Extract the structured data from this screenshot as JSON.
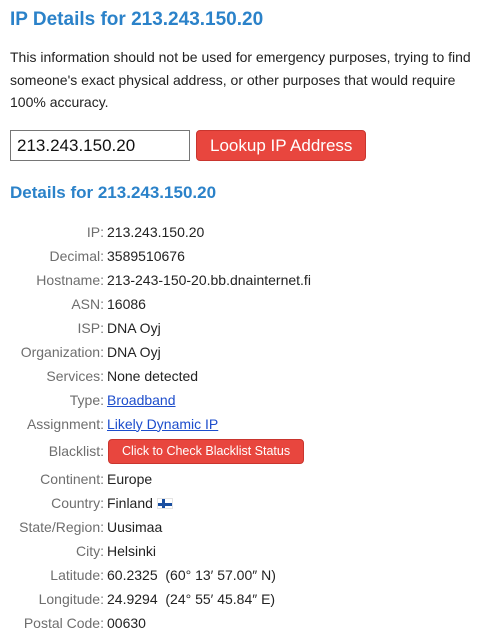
{
  "page": {
    "title": "IP Details for 213.243.150.20",
    "disclaimer": "This information should not be used for emergency purposes, trying to find someone's exact physical address, or other purposes that would require 100% accuracy."
  },
  "lookup": {
    "input_value": "213.243.150.20",
    "button_label": "Lookup IP Address"
  },
  "details": {
    "title": "Details for 213.243.150.20",
    "ip": {
      "label": "IP:",
      "value": "213.243.150.20"
    },
    "decimal": {
      "label": "Decimal:",
      "value": "3589510676"
    },
    "hostname": {
      "label": "Hostname:",
      "value": "213-243-150-20.bb.dnainternet.fi"
    },
    "asn": {
      "label": "ASN:",
      "value": "16086"
    },
    "isp": {
      "label": "ISP:",
      "value": "DNA Oyj"
    },
    "organization": {
      "label": "Organization:",
      "value": "DNA Oyj"
    },
    "services": {
      "label": "Services:",
      "value": "None detected"
    },
    "type": {
      "label": "Type:",
      "value": "Broadband"
    },
    "assignment": {
      "label": "Assignment:",
      "value": "Likely Dynamic IP"
    },
    "blacklist": {
      "label": "Blacklist:",
      "button_label": "Click to Check Blacklist Status"
    },
    "continent": {
      "label": "Continent:",
      "value": "Europe"
    },
    "country": {
      "label": "Country:",
      "value": "Finland",
      "flag_icon": "finland-flag-icon"
    },
    "state_region": {
      "label": "State/Region:",
      "value": "Uusimaa"
    },
    "city": {
      "label": "City:",
      "value": "Helsinki"
    },
    "latitude": {
      "label": "Latitude:",
      "value": "60.2325",
      "dms": "(60° 13′ 57.00″ N)"
    },
    "longitude": {
      "label": "Longitude:",
      "value": "24.9294",
      "dms": "(24° 55′ 45.84″ E)"
    },
    "postal_code": {
      "label": "Postal Code:",
      "value": "00630"
    }
  },
  "colors": {
    "heading": "#2b82c9",
    "button": "#e8463e",
    "link": "#1d4dcc",
    "label": "#6e6e6e"
  }
}
